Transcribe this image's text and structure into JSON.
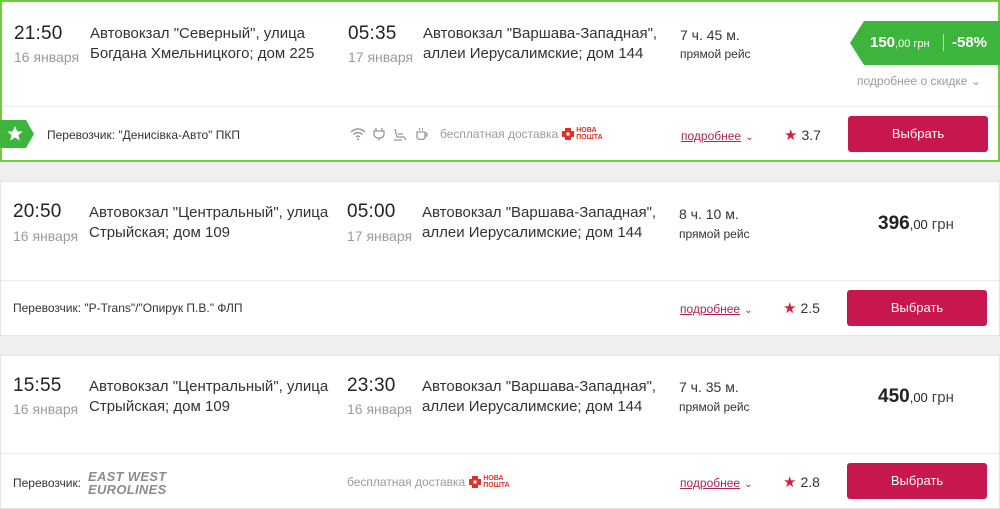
{
  "trips": [
    {
      "dep_time": "21:50",
      "dep_date": "16 января",
      "dep_station_l1": "Автовокзал \"Северный\", улица",
      "dep_station_l2": "Богдана Хмельницкого; дом 225",
      "arr_time": "05:35",
      "arr_date": "17 января",
      "arr_station_l1": "Автовокзал \"Варшава-Западная\",",
      "arr_station_l2": "аллеи Иерусалимские; дом 144",
      "duration": "7 ч. 45 м.",
      "route_type": "прямой рейс",
      "price_main": "150",
      "price_cents": ",00",
      "currency": "грн",
      "discount": "-58%",
      "discount_more": "подробнее о скидке",
      "carrier": "Перевозчик: \"Денисівка-Авто\" ПКП",
      "delivery": "бесплатная доставка",
      "details": "подробнее",
      "rating": "3.7",
      "select": "Выбрать"
    },
    {
      "dep_time": "20:50",
      "dep_date": "16 января",
      "dep_station_l1": "Автовокзал \"Центральный\", улица",
      "dep_station_l2": "Стрыйская; дом 109",
      "arr_time": "05:00",
      "arr_date": "17 января",
      "arr_station_l1": "Автовокзал \"Варшава-Западная\",",
      "arr_station_l2": "аллеи Иерусалимские; дом 144",
      "duration": "8 ч. 10 м.",
      "route_type": "прямой рейс",
      "price_main": "396",
      "price_cents": ",00",
      "currency": "грн",
      "carrier": "Перевозчик: \"P-Trans\"/\"Опирук П.В.\" ФЛП",
      "details": "подробнее",
      "rating": "2.5",
      "select": "Выбрать"
    },
    {
      "dep_time": "15:55",
      "dep_date": "16 января",
      "dep_station_l1": "Автовокзал \"Центральный\", улица",
      "dep_station_l2": "Стрыйская; дом 109",
      "arr_time": "23:30",
      "arr_date": "16 января",
      "arr_station_l1": "Автовокзал \"Варшава-Западная\",",
      "arr_station_l2": "аллеи Иерусалимские; дом 144",
      "duration": "7 ч. 35 м.",
      "route_type": "прямой рейс",
      "price_main": "450",
      "price_cents": ",00",
      "currency": "грн",
      "carrier": "Перевозчик:",
      "carrier_logo_l1": "EAST WEST",
      "carrier_logo_l2": "EUROLINES",
      "delivery": "бесплатная доставка",
      "details": "подробнее",
      "rating": "2.8",
      "select": "Выбрать"
    }
  ],
  "delivery_logo": {
    "l1": "НОВА",
    "l2": "ПОШТА"
  },
  "colors": {
    "accent": "#c8164f",
    "green": "#3db53d",
    "highlight_border": "#6ccf3a",
    "star": "#d6203f"
  },
  "icons": [
    "wifi-icon",
    "socket-icon",
    "seat-icon",
    "coffee-icon",
    "star-icon",
    "chevron-down-icon"
  ]
}
